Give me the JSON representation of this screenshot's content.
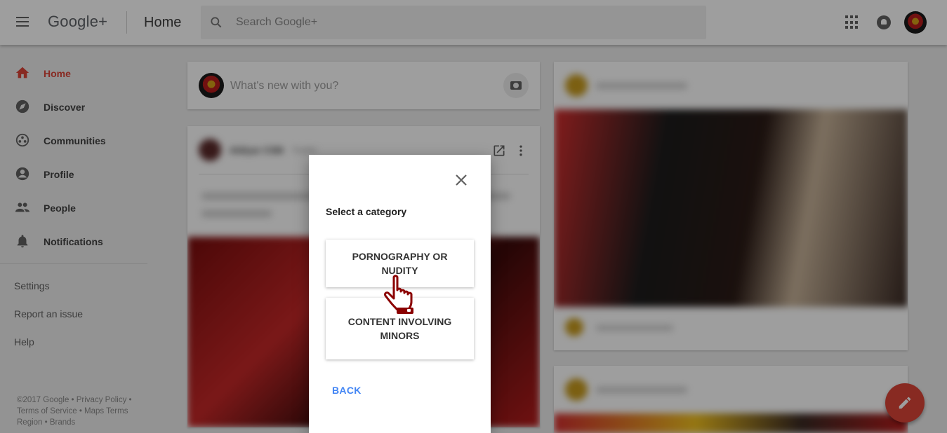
{
  "app": {
    "logo_text": "Google+",
    "page_title": "Home"
  },
  "search": {
    "placeholder": "Search Google+"
  },
  "sidebar": {
    "items": [
      {
        "label": "Home",
        "icon": "home-icon",
        "active": true
      },
      {
        "label": "Discover",
        "icon": "compass-icon"
      },
      {
        "label": "Communities",
        "icon": "communities-icon"
      },
      {
        "label": "Profile",
        "icon": "profile-icon"
      },
      {
        "label": "People",
        "icon": "people-icon"
      },
      {
        "label": "Notifications",
        "icon": "bell-icon"
      }
    ],
    "links": [
      "Settings",
      "Report an issue",
      "Help"
    ],
    "footer": {
      "line1": "©2017 Google • Privacy Policy •",
      "line2": "Terms of Service • Maps Terms",
      "line3": "Region • Brands"
    }
  },
  "composer": {
    "placeholder": "What's new with you?"
  },
  "post": {
    "author": "Aldiyar CSM",
    "visibility": "Public"
  },
  "dialog": {
    "title": "Select a category",
    "options": [
      "PORNOGRAPHY OR NUDITY",
      "CONTENT INVOLVING MINORS"
    ],
    "back_label": "BACK"
  },
  "colors": {
    "accent_red": "#db4437",
    "link_blue": "#4285f4",
    "hand_cursor": "#8b0000"
  }
}
